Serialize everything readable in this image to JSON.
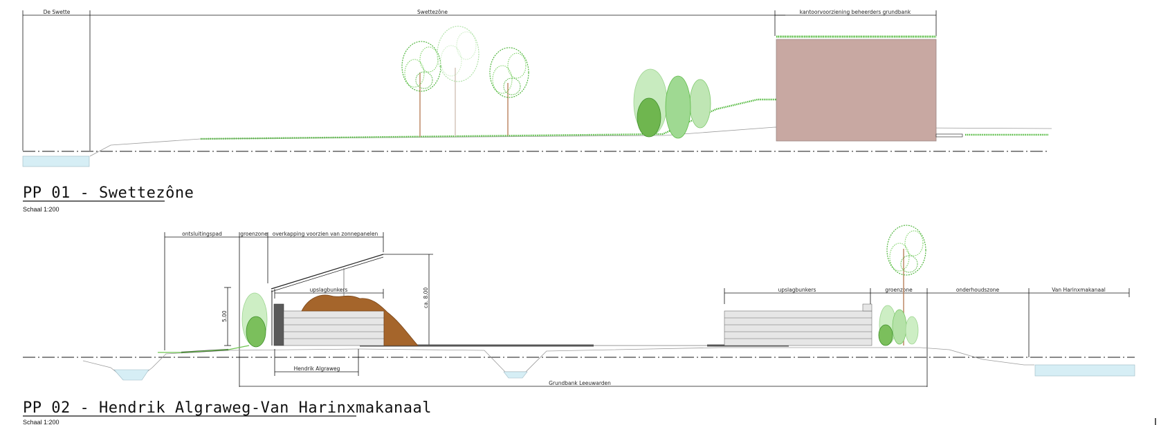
{
  "section1": {
    "title": "PP 01 - Swettezône",
    "scale": "Schaal 1:200",
    "labels": {
      "swette": "De Swette",
      "swettezone": "Swettezône",
      "kantoor": "kantoorvoorziening beheerders grundbank"
    },
    "colors": {
      "building": "#c8a8a2",
      "tree_green": "#3fae2b",
      "tree_pale": "#a9dfa0",
      "grass": "#4fb83a",
      "water": "#d6eef5"
    }
  },
  "section2": {
    "title": "PP 02 - Hendrik Algraweg-Van Harinxmakanaal",
    "scale": "Schaal 1:200",
    "labels": {
      "ontsluitingspad": "ontsluitingspad",
      "groenzone_left": "groenzone",
      "overkapping": "overkapping voorzien van zonnepanelen",
      "upslagbunkers_left": "upslagbunkers",
      "upslagbunkers_right": "upslagbunkers",
      "groenzone_right": "groenzone",
      "onderhoudszone": "onderhoudszone",
      "van_harinxmakanaal": "Van Harinxmakanaal",
      "hendrik_algraweg": "Hendrik Algraweg",
      "grundbank": "Grundbank Leeuwarden",
      "height_500": "5.00",
      "height_800": "ca. 8.00"
    },
    "colors": {
      "soil": "#a5652b",
      "brick": "#e6e6e6",
      "wall_dark": "#5a5a5a"
    }
  }
}
